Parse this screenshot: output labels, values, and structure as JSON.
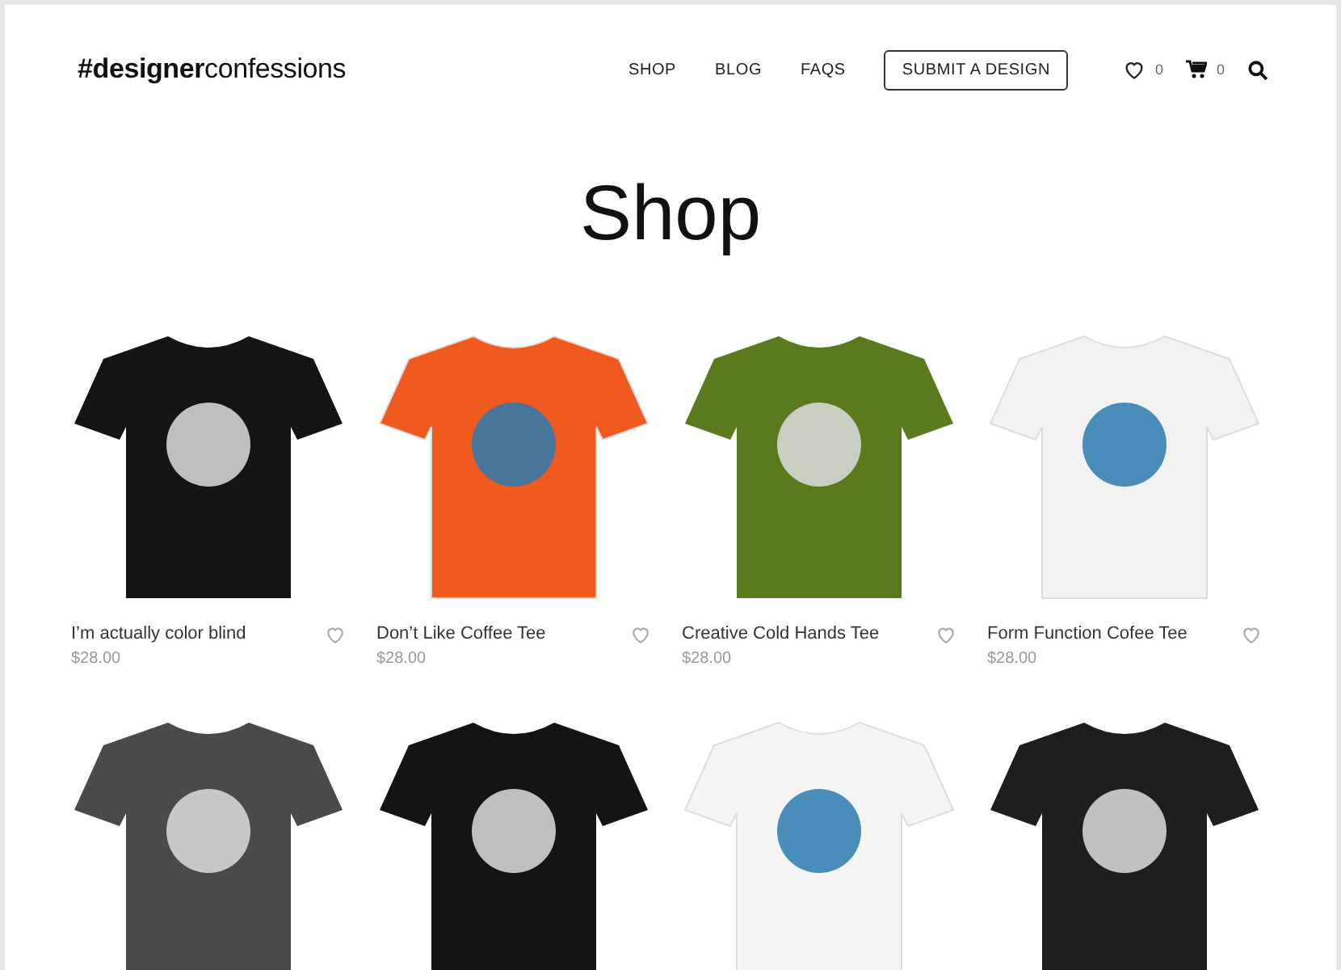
{
  "header": {
    "logo": "**#designer**confessions",
    "nav": [
      {
        "label": "SHOP",
        "kind": "link"
      },
      {
        "label": "BLOG",
        "kind": "link"
      },
      {
        "label": "FAQS",
        "kind": "link"
      },
      {
        "label": "SUBMIT A DESIGN",
        "kind": "outlined"
      }
    ],
    "wishlist_count": "0",
    "cart_count": "0"
  },
  "title": "Shop",
  "products": [
    {
      "name": "I’m actually color blind",
      "price": "$28.00",
      "color": "#141414"
    },
    {
      "name": "Don’t Like Coffee Tee",
      "price": "$28.00",
      "color": "#f05a1e"
    },
    {
      "name": "Creative Cold Hands Tee",
      "price": "$28.00",
      "color": "#5a7a1e"
    },
    {
      "name": "Form Function Cofee Tee",
      "price": "$28.00",
      "color": "#f2f2f2"
    },
    {
      "color": "#4a4a4a"
    },
    {
      "color": "#141414"
    },
    {
      "color": "#f4f4f4"
    },
    {
      "color": "#1e1e1e"
    }
  ]
}
